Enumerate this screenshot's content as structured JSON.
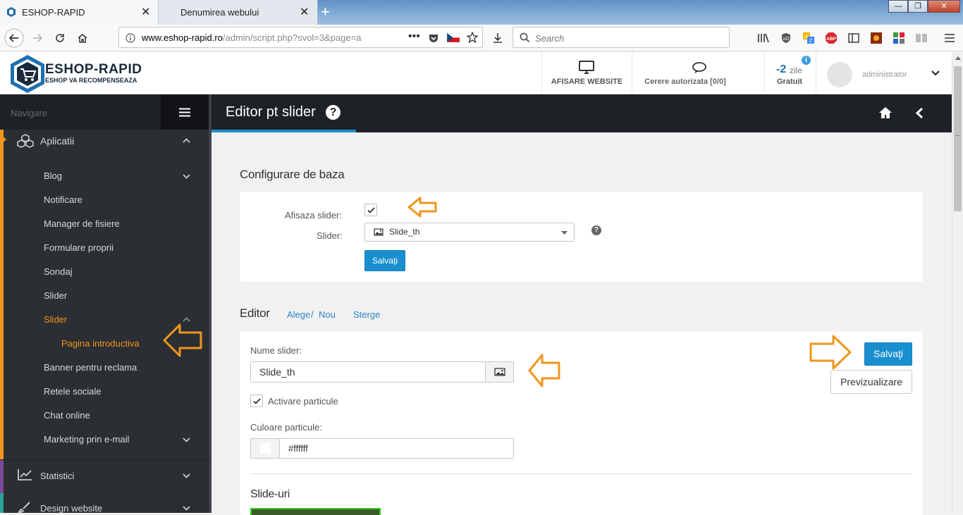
{
  "browser": {
    "tabs": [
      {
        "label": "ESHOP-RAPID"
      },
      {
        "label": "Denumirea webului"
      }
    ],
    "url_host": "www.eshop-rapid.ro",
    "url_rest": "/admin/script.php?svol=3&page=a",
    "search_placeholder": "Search",
    "window_buttons": {
      "minimize": "—",
      "maximize": "❐",
      "close": "✕"
    }
  },
  "header": {
    "brand": "ESHOP-RAPID",
    "tagline": "ESHOP VA RECOMPENSEAZA",
    "website_label": "AFISARE WEBSITE",
    "requests_label": "Cerere autorizata [0/0]",
    "days_value": "-2",
    "days_unit": "zile",
    "plan_label": "Gratuit",
    "info_icon_text": "i",
    "user_name": "administrator"
  },
  "sidebar": {
    "nav_label": "Navigare",
    "sections": [
      {
        "label": "Aplicatii",
        "icon": "cubes-icon"
      },
      {
        "label": "Statistici",
        "icon": "chart-icon"
      },
      {
        "label": "Design website",
        "icon": "brush-icon"
      }
    ],
    "items": [
      {
        "label": "Blog",
        "has_chevron": true
      },
      {
        "label": "Notificare"
      },
      {
        "label": "Manager de fisiere"
      },
      {
        "label": "Formulare proprii"
      },
      {
        "label": "Sondaj"
      },
      {
        "label": "Slider"
      },
      {
        "label": "Slider",
        "active": true,
        "expanded": true
      },
      {
        "label": "Pagina introductiva",
        "sub": true,
        "active": true
      },
      {
        "label": "Banner pentru reclama"
      },
      {
        "label": "Retele sociale"
      },
      {
        "label": "Chat online"
      },
      {
        "label": "Marketing prin e-mail",
        "has_chevron": true
      }
    ]
  },
  "main": {
    "title": "Editor pt slider",
    "help_glyph": "?",
    "basic_section": "Configurare de baza",
    "show_slider_label": "Afisaza slider:",
    "show_slider_checked": true,
    "slider_label": "Slider:",
    "slider_selected": "Slide_th",
    "help_icon_text": "?",
    "save_label_1": "Salvaţi",
    "editor_section": "Editor",
    "choose_link": "Alege",
    "link_separator": "/",
    "new_link": "Nou",
    "delete_link": "Sterge",
    "name_label": "Nume slider:",
    "name_value": "Slide_th",
    "particles_label": "Activare particule",
    "particles_checked": true,
    "particle_color_label": "Culoare particule:",
    "particle_color_value": "#ffffff",
    "save_label_2": "Salvaţi",
    "preview_label": "Previzualizare",
    "slides_section": "Slide-uri"
  },
  "colors": {
    "accent_orange": "#f0961c",
    "primary_blue": "#1a8fcf",
    "sidebar_bg": "#2b2e33",
    "titlebar_bg": "#1e2125"
  }
}
